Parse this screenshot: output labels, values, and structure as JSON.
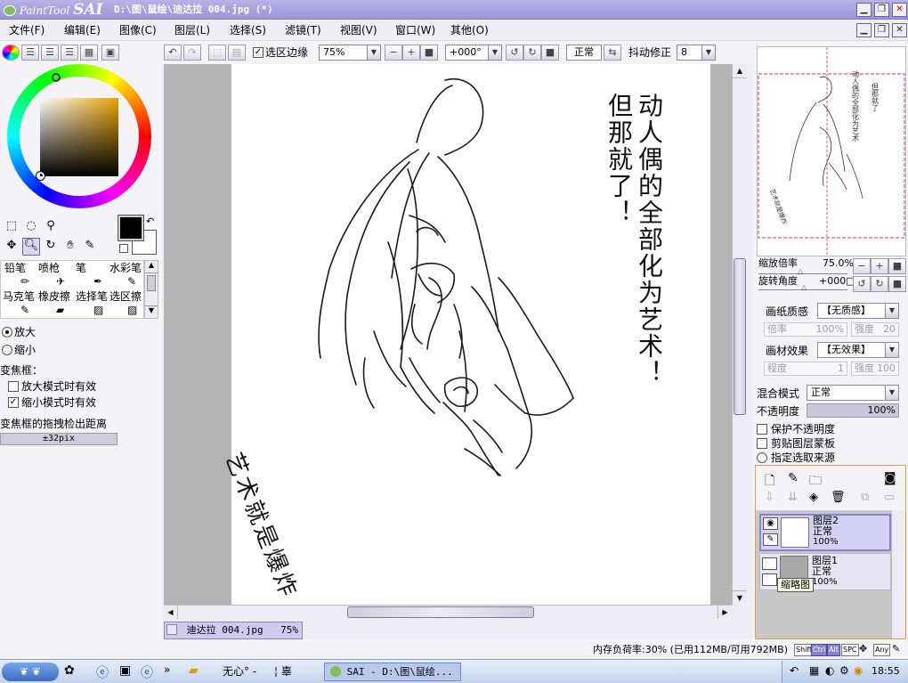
{
  "titlebar": {
    "app_name": "PaintTool",
    "app_brand": "SAI",
    "document_title": "D:\\图\\鼠绘\\迪达拉 004.jpg (*)",
    "mdi_title_buttons": [
      "_",
      "□",
      "×"
    ]
  },
  "menubar": {
    "items": [
      "文件(F)",
      "编辑(E)",
      "图像(C)",
      "图层(L)",
      "选择(S)",
      "滤镜(T)",
      "视图(V)",
      "窗口(W)",
      "其他(O)"
    ]
  },
  "toolbar": {
    "selection_edge_label": "选区边缘",
    "selection_edge_checked": true,
    "zoom_value": "75%",
    "rotation_value": "+000°",
    "blend_mode": "正常",
    "stabilizer_label": "抖动修正",
    "stabilizer_value": "8"
  },
  "left_panel": {
    "tools_row1": [
      "铅笔",
      "喷枪",
      "笔",
      "水彩笔"
    ],
    "tools_row2": [
      "马克笔",
      "橡皮擦",
      "选择笔",
      "选区擦"
    ],
    "zoom_in_label": "放大",
    "zoom_out_label": "缩小",
    "zoom_in_selected": true,
    "frame_label": "变焦框：",
    "frame_opt1": "放大模式时有效",
    "frame_opt1_checked": false,
    "frame_opt2": "缩小模式时有效",
    "frame_opt2_checked": true,
    "drag_label": "变焦框的拖拽检出距离",
    "drag_value": "±32pix",
    "primary_color": "#000000",
    "secondary_color": "#ffffff",
    "hue_color": "#e8a200"
  },
  "canvas_text": {
    "column1": "动人偶的全部化为艺术！",
    "column2": "但那就了！",
    "bottom": "艺术就是爆炸"
  },
  "right_panel": {
    "zoom_label": "缩放倍率",
    "zoom_value": "75.0%",
    "rotate_label": "旋转角度",
    "rotate_value": "+000□",
    "paper_texture_label": "画纸质感",
    "paper_texture_value": "【无质感】",
    "scale_label": "倍率",
    "scale_value": "100%",
    "strength_label": "强度",
    "strength_value": "20",
    "effect_label": "画材效果",
    "effect_value": "【无效果】",
    "degree_label": "程度",
    "degree_value": "1",
    "strength2_label": "强度",
    "strength2_value": "100",
    "blend_label": "混合模式",
    "blend_value": "正常",
    "opacity_label": "不透明度",
    "opacity_value": "100%",
    "opacity_fraction": 1.0,
    "protect_opacity": "保护不透明度",
    "clip_layer": "剪贴图层蒙板",
    "selection_source": "指定选取来源",
    "layers": [
      {
        "name": "图层2",
        "mode": "正常",
        "opacity": "100%",
        "selected": true
      },
      {
        "name": "图层1",
        "mode": "正常",
        "opacity": "100%",
        "selected": false
      }
    ],
    "thumbnail_tooltip": "缩略图"
  },
  "doc_tab": {
    "name": "迪达拉 004.jpg",
    "zoom": "75%"
  },
  "statusbar": {
    "memory": "内存负荷率:30% (已用112MB/可用792MB)",
    "keys": [
      "Shift",
      "Ctrl",
      "Alt",
      "SPC",
      "Any"
    ]
  },
  "taskbar": {
    "item1": "无心° -",
    "item2": "¦ 辜",
    "sai_window": "SAI - D:\\图\\鼠绘...",
    "time": "18:55"
  },
  "colors": {
    "titlebar": "#9a94d6",
    "selection_accent": "#8a84d0"
  }
}
